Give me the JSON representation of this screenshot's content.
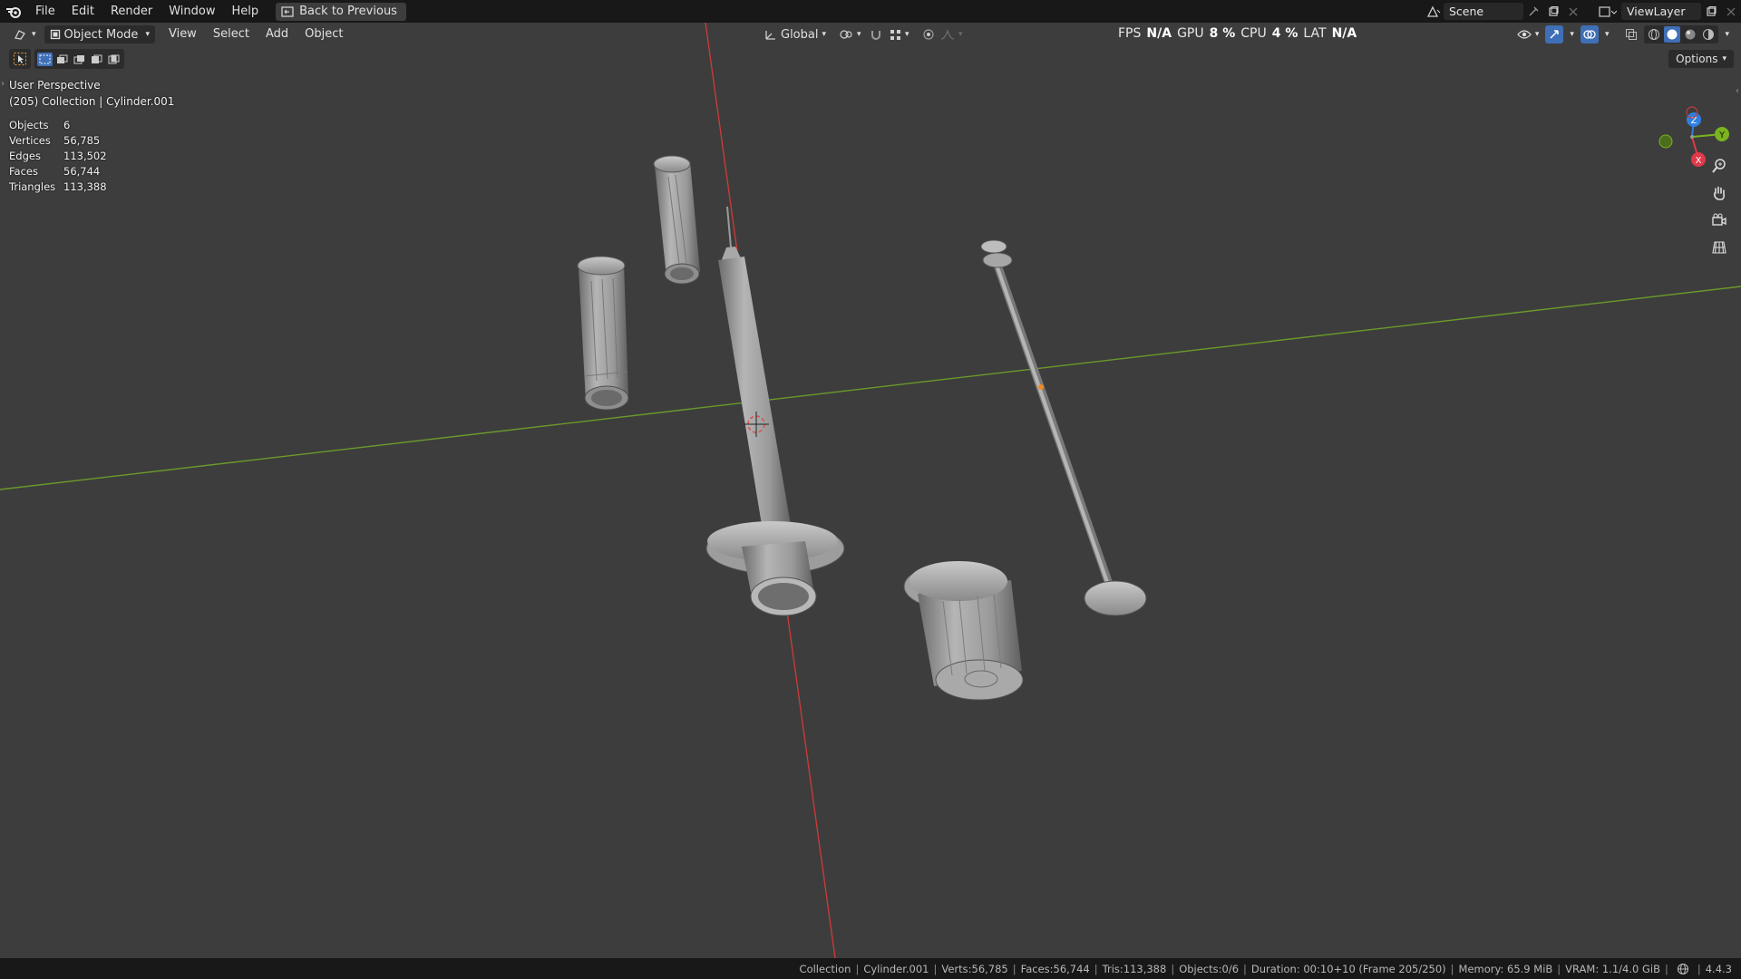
{
  "topbar": {
    "menus": [
      "File",
      "Edit",
      "Render",
      "Window",
      "Help"
    ],
    "back_button": "Back to Previous",
    "scene": "Scene",
    "view_layer": "ViewLayer"
  },
  "viewport_header": {
    "mode": "Object Mode",
    "menus": [
      "View",
      "Select",
      "Add",
      "Object"
    ],
    "transform_orientation": "Global",
    "options": "Options"
  },
  "perf": {
    "fps_label": "FPS",
    "fps_value": "N/A",
    "gpu_label": "GPU",
    "gpu_value": "8 %",
    "cpu_label": "CPU",
    "cpu_value": "4 %",
    "lat_label": "LAT",
    "lat_value": "N/A"
  },
  "overlay": {
    "view_name": "User Perspective",
    "context": "(205) Collection | Cylinder.001"
  },
  "stats": [
    {
      "key": "Objects",
      "value": "6"
    },
    {
      "key": "Vertices",
      "value": "56,785"
    },
    {
      "key": "Edges",
      "value": "113,502"
    },
    {
      "key": "Faces",
      "value": "56,744"
    },
    {
      "key": "Triangles",
      "value": "113,388"
    }
  ],
  "gizmo": {
    "z": "Z",
    "y": "Y",
    "x": "X"
  },
  "statusbar": {
    "collection": "Collection",
    "object": "Cylinder.001",
    "verts": "Verts:56,785",
    "faces": "Faces:56,744",
    "tris": "Tris:113,388",
    "objects": "Objects:0/6",
    "duration": "Duration: 00:10+10 (Frame 205/250)",
    "memory": "Memory: 65.9 MiB",
    "vram": "VRAM: 1.1/4.0 GiB",
    "version": "4.4.3"
  },
  "colors": {
    "viewport_bg": "#3d3d3d",
    "x_axis": "#c93a3a",
    "y_axis": "#6a9a2a",
    "gizmo_z": "#2f7fdf",
    "gizmo_y": "#7ab41e",
    "gizmo_x": "#e0394a",
    "active_blue": "#3f6fb6"
  }
}
